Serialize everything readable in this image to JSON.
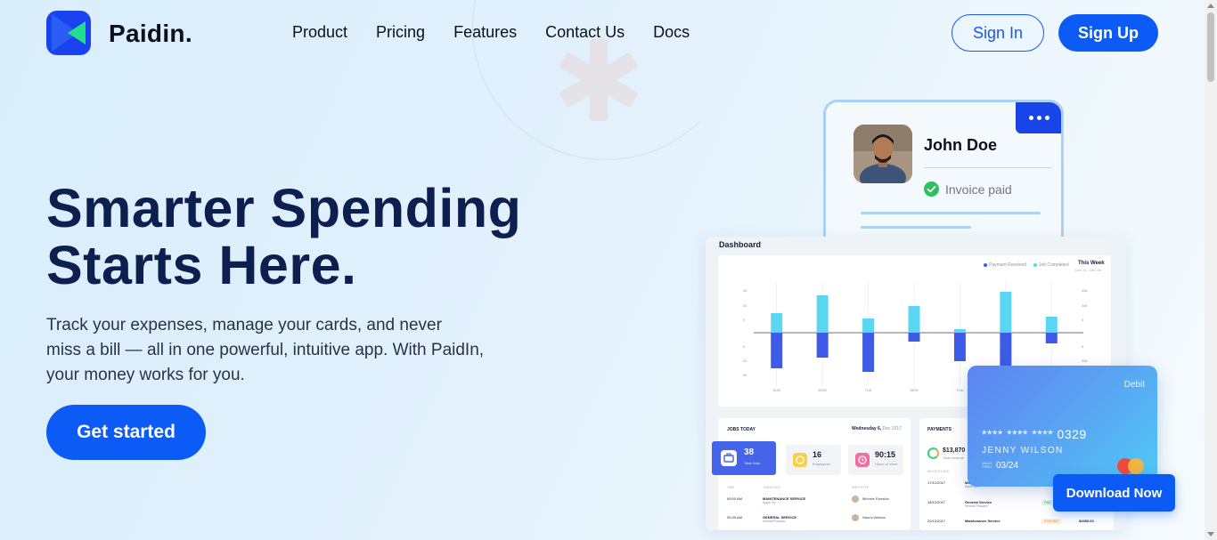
{
  "header": {
    "brand": "Paidin.",
    "nav": [
      "Product",
      "Pricing",
      "Features",
      "Contact Us",
      "Docs"
    ],
    "signin_label": "Sign In",
    "signup_label": "Sign Up"
  },
  "hero": {
    "title_lines": [
      "Smarter Spending",
      "Starts Here."
    ],
    "subtitle_lines": [
      "Track your expenses, manage your cards, and never",
      "miss a bill — all in one powerful, intuitive app. With PaidIn,",
      "your money works for you."
    ],
    "cta_label": "Get started"
  },
  "profile_card": {
    "name": "John Doe",
    "status": "Invoice paid"
  },
  "dashboard": {
    "title": "Dashboard",
    "legend": [
      "Payment Received",
      "Job Completed"
    ],
    "period": "This Week",
    "period_range": "Dec 31 - Dec 06",
    "jobs": {
      "title": "JOBS TODAY",
      "date": "Wednesday 6,",
      "date_suffix": "Dec 2017",
      "stats": [
        {
          "value": "38",
          "label": "Total Jobs"
        },
        {
          "value": "16",
          "label": "Employees"
        },
        {
          "value": "90:15",
          "label": "Hours of Work"
        }
      ],
      "columns": [
        "TIME",
        "JOB/CLIENT",
        "EMPLOYEE"
      ],
      "rows": [
        {
          "time": "09:00 AM",
          "service": "MAINTENANCE SERVICE",
          "client": "Apple Inc.",
          "employee": "Michele Ronaldo"
        },
        {
          "time": "09:30 AM",
          "service": "GENERAL SERVICE",
          "client": "Hewlett Packard",
          "employee": "Naomi Watson"
        }
      ]
    },
    "payments": {
      "title": "PAYMENTS",
      "total": "$13,870",
      "total_label": "Total revenue",
      "columns": [
        "INVOICE DATE"
      ],
      "rows": [
        {
          "date": "17/12/2017",
          "service": "Ma...",
          "client": "Apple Inc.",
          "status": "",
          "amount": ""
        },
        {
          "date": "18/12/2017",
          "service": "General Service",
          "client": "Hewlett Packard",
          "status": "PAID",
          "amount": "$14,00"
        },
        {
          "date": "20/12/2017",
          "service": "Maintenance Service",
          "client": "",
          "status": "PENDING",
          "amount": "$4350.00"
        }
      ]
    }
  },
  "chart_data": {
    "type": "bar",
    "categories": [
      "SUN",
      "MON",
      "TUE",
      "WED",
      "THU",
      "FRI",
      "SAT"
    ],
    "series": [
      {
        "name": "Payment Received",
        "values": [
          -20,
          -14,
          -22,
          -5,
          -16,
          -20,
          -6
        ],
        "color": "#3d5be6"
      },
      {
        "name": "Job Completed",
        "values": [
          11,
          21,
          8,
          15,
          2,
          23,
          9
        ],
        "color": "#5ad6f2"
      }
    ],
    "left_ticks": [
      "40",
      "20",
      "0",
      "0",
      "20",
      "40"
    ],
    "right_ticks": [
      "40k",
      "20k",
      "0",
      "0",
      "20k",
      "40k"
    ],
    "ylim": [
      -25,
      25
    ]
  },
  "debit_card": {
    "type": "Debit",
    "number": "**** **** **** 0329",
    "holder": "JENNY WILSON",
    "valid_label": "VALID THRU",
    "expiry": "03/24"
  },
  "download_label": "Download Now",
  "colors": {
    "primary": "#0d5bf7",
    "title": "#0c1f4e",
    "card_border": "#a9d2f5"
  }
}
